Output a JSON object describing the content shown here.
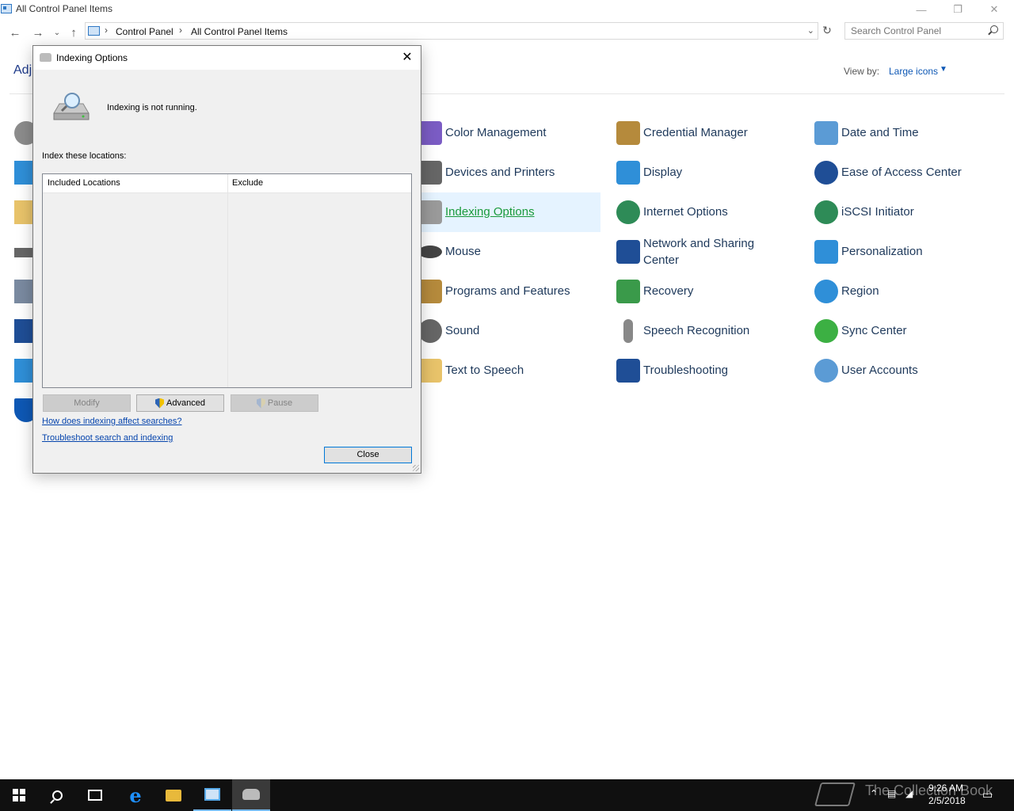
{
  "window": {
    "title": "All Control Panel Items"
  },
  "address": {
    "crumbs": [
      "Control Panel",
      "All Control Panel Items"
    ]
  },
  "search": {
    "placeholder": "Search Control Panel"
  },
  "heading": "Adj",
  "view": {
    "label": "View by:",
    "value": "Large icons"
  },
  "items": [
    {
      "label": "Color Management",
      "icon": "color-management-icon",
      "color": "#7b5cc4"
    },
    {
      "label": "Credential Manager",
      "icon": "credential-manager-icon",
      "color": "#b58a3c"
    },
    {
      "label": "Date and Time",
      "icon": "date-time-icon",
      "color": "#5b9bd5"
    },
    {
      "label": "Devices and Printers",
      "icon": "printer-icon",
      "color": "#666666"
    },
    {
      "label": "Display",
      "icon": "display-icon",
      "color": "#2f8fd8"
    },
    {
      "label": "Ease of Access Center",
      "icon": "ease-of-access-icon",
      "color": "#1f4e96"
    },
    {
      "label": "Indexing Options",
      "icon": "indexing-options-icon",
      "color": "#9a9a9a"
    },
    {
      "label": "Internet Options",
      "icon": "internet-options-icon",
      "color": "#2e8b57"
    },
    {
      "label": "iSCSI Initiator",
      "icon": "iscsi-initiator-icon",
      "color": "#2e8b57"
    },
    {
      "label": "Mouse",
      "icon": "mouse-icon",
      "color": "#444444"
    },
    {
      "label": "Network and Sharing Center",
      "icon": "network-icon",
      "color": "#1f4e96"
    },
    {
      "label": "Personalization",
      "icon": "personalization-icon",
      "color": "#2f8fd8"
    },
    {
      "label": "Programs and Features",
      "icon": "programs-features-icon",
      "color": "#b58a3c"
    },
    {
      "label": "Recovery",
      "icon": "recovery-icon",
      "color": "#3a9a4a"
    },
    {
      "label": "Region",
      "icon": "region-icon",
      "color": "#2f8fd8"
    },
    {
      "label": "Sound",
      "icon": "sound-icon",
      "color": "#666666"
    },
    {
      "label": "Speech Recognition",
      "icon": "microphone-icon",
      "color": "#888888"
    },
    {
      "label": "Sync Center",
      "icon": "sync-center-icon",
      "color": "#3cb043"
    },
    {
      "label": "Text to Speech",
      "icon": "text-to-speech-icon",
      "color": "#e8c36a"
    },
    {
      "label": "Troubleshooting",
      "icon": "troubleshooting-icon",
      "color": "#1f4e96"
    },
    {
      "label": "User Accounts",
      "icon": "user-accounts-icon",
      "color": "#5b9bd5"
    }
  ],
  "dialog": {
    "title": "Indexing Options",
    "status": "Indexing is not running.",
    "index_label": "Index these locations:",
    "columns": [
      "Included Locations",
      "Exclude"
    ],
    "buttons": {
      "modify": "Modify",
      "advanced": "Advanced",
      "pause": "Pause",
      "close": "Close"
    },
    "links": [
      "How does indexing affect searches?",
      "Troubleshoot search and indexing"
    ]
  },
  "taskbar": {
    "time": "9:26 AM",
    "date": "2/5/2018",
    "watermark": "The Collection Book"
  }
}
